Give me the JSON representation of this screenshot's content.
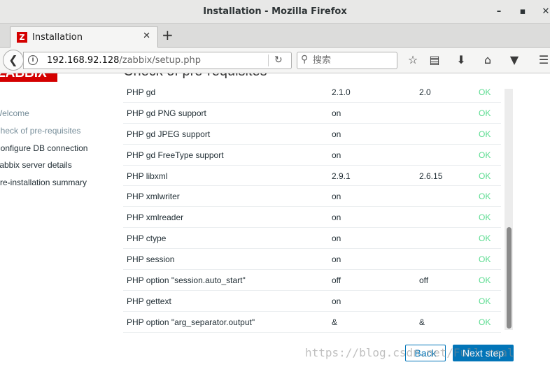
{
  "window": {
    "title": "Installation - Mozilla Firefox",
    "minimize": "–",
    "maximize": "▪",
    "close": "✕"
  },
  "tabs": [
    {
      "label": "Installation",
      "favicon": "Z",
      "close": "✕"
    }
  ],
  "newtab": "+",
  "nav": {
    "url_host": "192.168.92.128",
    "url_path": "/zabbix/setup.php",
    "search_placeholder": "搜索"
  },
  "page": {
    "logo": "ZABBIX",
    "heading": "Check of pre-requisites",
    "steps": [
      {
        "label": "Welcome",
        "state": "done"
      },
      {
        "label": "Check of pre-requisites",
        "state": "current"
      },
      {
        "label": "Configure DB connection",
        "state": "todo"
      },
      {
        "label": "Zabbix server details",
        "state": "todo"
      },
      {
        "label": "Pre-installation summary",
        "state": "todo"
      }
    ],
    "requirements": [
      {
        "name": "PHP gd",
        "current": "2.1.0",
        "required": "2.0",
        "status": "OK"
      },
      {
        "name": "PHP gd PNG support",
        "current": "on",
        "required": "",
        "status": "OK"
      },
      {
        "name": "PHP gd JPEG support",
        "current": "on",
        "required": "",
        "status": "OK"
      },
      {
        "name": "PHP gd FreeType support",
        "current": "on",
        "required": "",
        "status": "OK"
      },
      {
        "name": "PHP libxml",
        "current": "2.9.1",
        "required": "2.6.15",
        "status": "OK"
      },
      {
        "name": "PHP xmlwriter",
        "current": "on",
        "required": "",
        "status": "OK"
      },
      {
        "name": "PHP xmlreader",
        "current": "on",
        "required": "",
        "status": "OK"
      },
      {
        "name": "PHP ctype",
        "current": "on",
        "required": "",
        "status": "OK"
      },
      {
        "name": "PHP session",
        "current": "on",
        "required": "",
        "status": "OK"
      },
      {
        "name": "PHP option \"session.auto_start\"",
        "current": "off",
        "required": "off",
        "status": "OK"
      },
      {
        "name": "PHP gettext",
        "current": "on",
        "required": "",
        "status": "OK"
      },
      {
        "name": "PHP option \"arg_separator.output\"",
        "current": "&",
        "required": "&",
        "status": "OK"
      }
    ],
    "back_label": "Back",
    "next_label": "Next step",
    "watermark": "https://blog.csdn.net/Full_real"
  },
  "colors": {
    "brand": "#d40000",
    "ok": "#59db8f",
    "button": "#0275b8"
  }
}
